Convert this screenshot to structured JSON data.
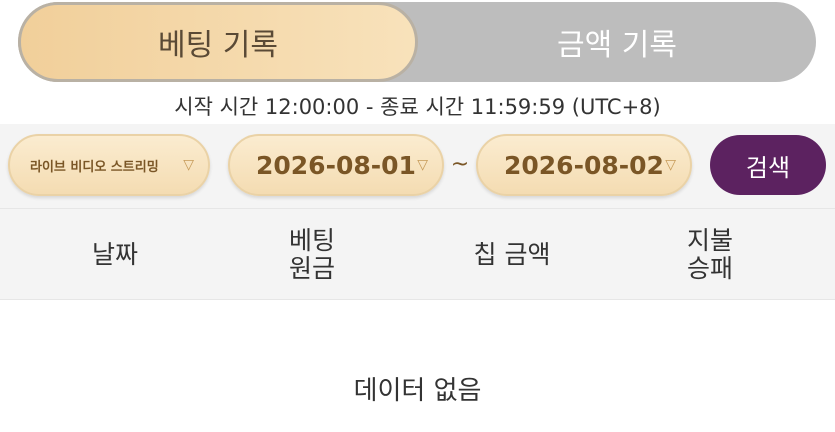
{
  "tabs": {
    "active_label": "베팅 기록",
    "inactive_label": "금액 기록"
  },
  "time_note": "시작 시간 12:00:00 - 종료 시간 11:59:59 (UTC+8)",
  "filters": {
    "source": "라이브 비디오 스트리밍",
    "start_date": "2026-08-01",
    "separator": "~",
    "end_date": "2026-08-02",
    "search_label": "검색"
  },
  "table": {
    "headers": [
      {
        "line1": "날짜",
        "line2": ""
      },
      {
        "line1": "베팅",
        "line2": "원금"
      },
      {
        "line1": "칩 금액",
        "line2": ""
      },
      {
        "line1": "지불",
        "line2": "승패"
      }
    ]
  },
  "empty_message": "데이터 없음",
  "colors": {
    "active_tab": "#f1cf9a",
    "inactive_tab": "#bdbdbd",
    "search_button": "#5c2260",
    "date_text": "#7a5626"
  }
}
